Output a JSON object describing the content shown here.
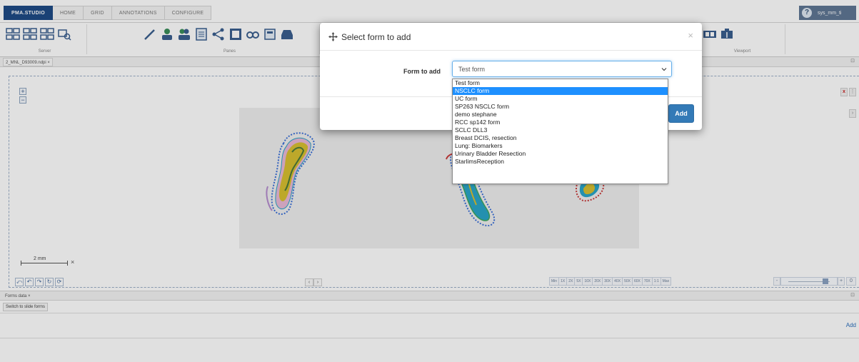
{
  "menubar": {
    "tabs": [
      {
        "label": "PMA.STUDIO",
        "brand": true
      },
      {
        "label": "HOME"
      },
      {
        "label": "GRID"
      },
      {
        "label": "ANNOTATIONS"
      },
      {
        "label": "CONFIGURE"
      }
    ],
    "username": "sys_mm_ti"
  },
  "ribbon": {
    "server_caption": "Server",
    "panes_caption": "Panes",
    "viewport_caption": "Viewport"
  },
  "doc_tab": {
    "label": "2_MNL_D93009.ndpi",
    "close": "×"
  },
  "viewer": {
    "zoom_in": "+",
    "zoom_out": "−",
    "scale_label": "2 mm",
    "scale_close": "×",
    "pager_prev": "‹",
    "pager_next": "›",
    "rotate_icons": [
      "⤺",
      "↶",
      "↷",
      "↻",
      "⟳"
    ],
    "zoom_levels": [
      "Min",
      "1X",
      "2X",
      "5X",
      "10X",
      "20X",
      "30X",
      "40X",
      "50X",
      "60X",
      "70X",
      "1:1",
      "Max"
    ],
    "zoom_minus": "-",
    "zoom_plus": "+",
    "zoom_value": "0",
    "side_close": "x"
  },
  "forms_panel": {
    "tab_label": "Forms data",
    "tab_close": "×",
    "switch_label": "Switch to slide forms",
    "add_label": "Add"
  },
  "modal": {
    "title": "Select form to add",
    "close": "×",
    "field_label": "Form to add",
    "selected_value": "Test form",
    "add_button": "Add"
  },
  "dropdown": {
    "options": [
      {
        "label": "Test form",
        "highlighted": false
      },
      {
        "label": "NSCLC form",
        "highlighted": true
      },
      {
        "label": "UC form",
        "highlighted": false
      },
      {
        "label": "SP263 NSCLC form",
        "highlighted": false
      },
      {
        "label": "demo stephane",
        "highlighted": false
      },
      {
        "label": "RCC sp142 form",
        "highlighted": false
      },
      {
        "label": "SCLC DLL3",
        "highlighted": false
      },
      {
        "label": "Breast DCIS, resection",
        "highlighted": false
      },
      {
        "label": "Lung: Biomarkers",
        "highlighted": false
      },
      {
        "label": "Urinary Bladder Resection",
        "highlighted": false
      },
      {
        "label": "StarlimsReception",
        "highlighted": false
      }
    ]
  },
  "colors": {
    "brand": "#1e4a86",
    "primary_button": "#337ab7",
    "option_highlight": "#1e90ff",
    "annotation_blue": "#3a6fd8",
    "tissue_yellow": "#d8c030",
    "tissue_teal": "#2aa4c8"
  }
}
